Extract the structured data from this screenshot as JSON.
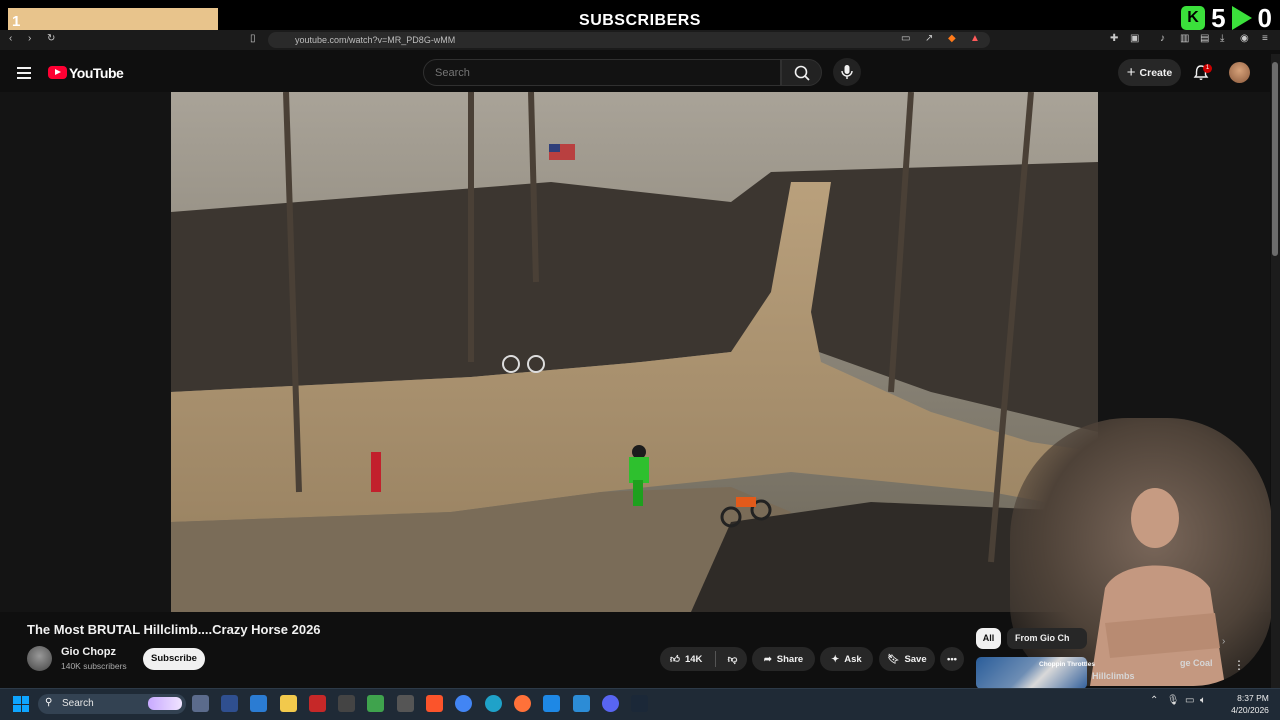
{
  "overlay": {
    "progress_number": "1",
    "title": "SUBSCRIBERS",
    "count_1": "5",
    "count_2": "0",
    "badge_glyph": "K",
    "accent": "#3be03b"
  },
  "browser": {
    "url": "youtube.com/watch?v=MR_PD8G-wMM"
  },
  "header": {
    "logo_text": "YouTube",
    "search_placeholder": "Search",
    "create_label": "Create",
    "notification_count": "1",
    "brand_color": "#ff0033"
  },
  "video": {
    "title": "The Most BRUTAL Hillclimb....Crazy Horse 2026",
    "channel": "Gio Chopz",
    "subscribers": "140K subscribers",
    "subscribe_label": "Subscribe",
    "likes": "14K",
    "share_label": "Share",
    "ask_label": "Ask",
    "save_label": "Save"
  },
  "sidebar": {
    "chips": [
      "All",
      "From Gio Ch"
    ],
    "related": {
      "thumb_text": "Choppin Throttles",
      "title_partial": "Hillclimbs",
      "title_partial2": "ge Coal"
    }
  },
  "taskbar": {
    "search_label": "Search",
    "time": "8:37 PM",
    "date": "4/20/2026"
  }
}
